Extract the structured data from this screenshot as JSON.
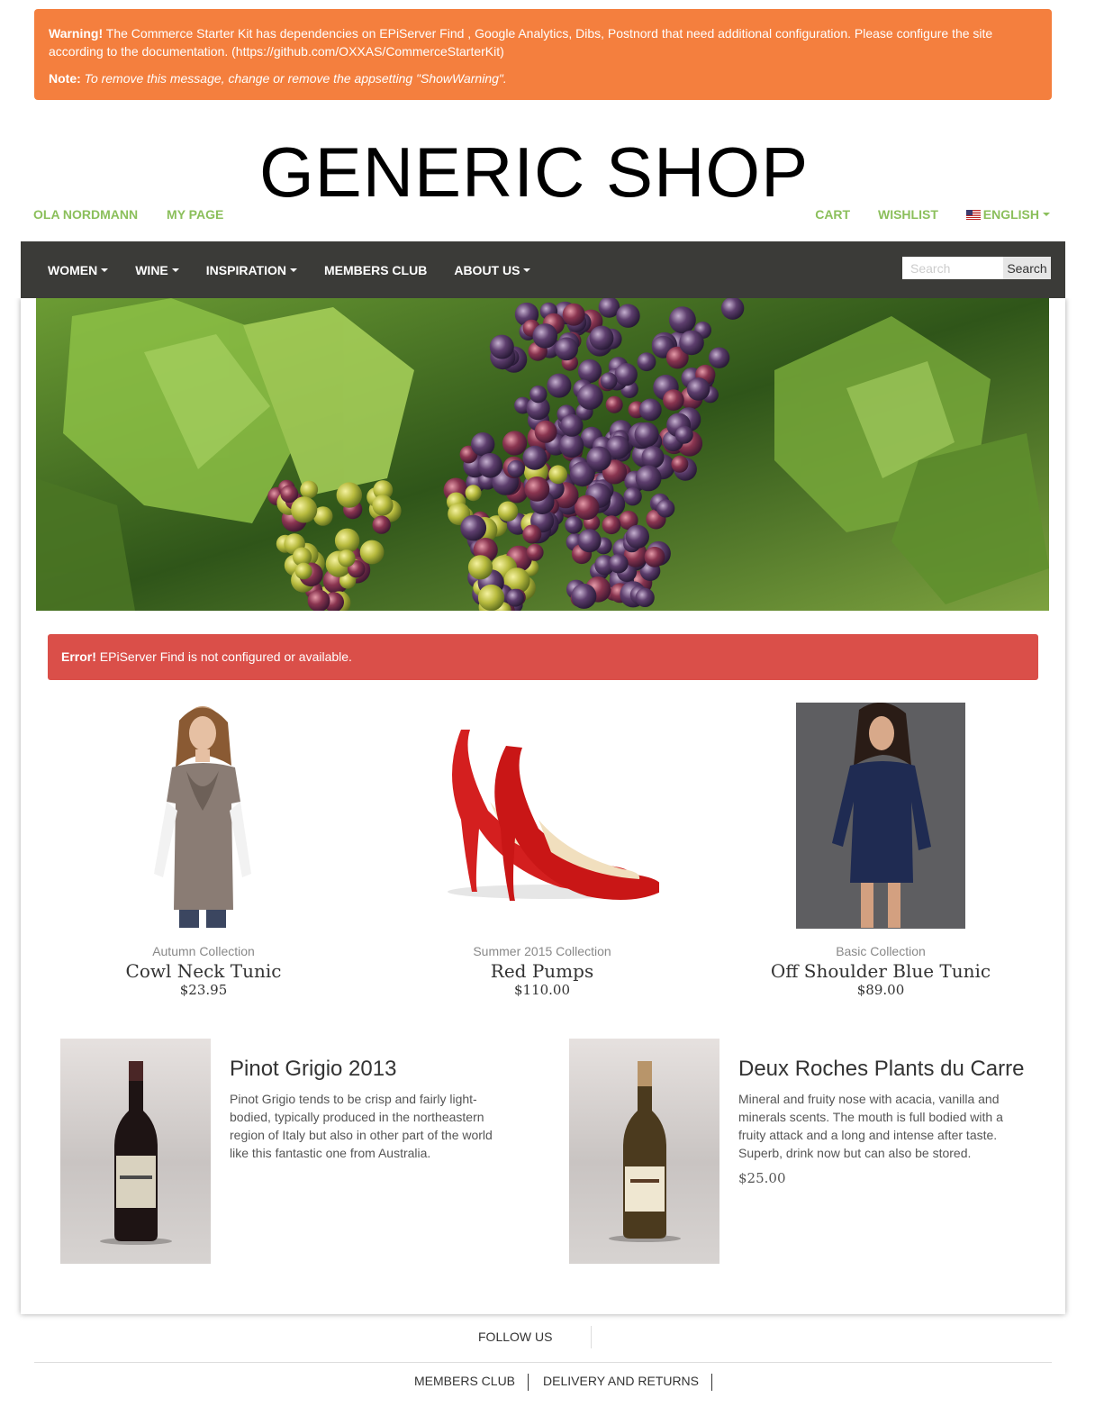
{
  "warning": {
    "label": "Warning!",
    "text": " The Commerce Starter Kit has dependencies on EPiServer Find , Google Analytics, Dibs, Postnord that need additional configuration. Please configure the site according to the documentation. (https://github.com/OXXAS/CommerceStarterKit)",
    "note_label": "Note:",
    "note_text": " To remove this message, change or remove the appsetting \"ShowWarning\"."
  },
  "logo": "GENERIC SHOP",
  "user_links": [
    "OLA NORDMANN",
    "MY PAGE"
  ],
  "account_links": {
    "cart": "CART",
    "wishlist": "WISHLIST",
    "language": "ENGLISH"
  },
  "nav": {
    "items": [
      {
        "label": "WOMEN",
        "dropdown": true
      },
      {
        "label": "WINE",
        "dropdown": true
      },
      {
        "label": "INSPIRATION",
        "dropdown": true
      },
      {
        "label": "MEMBERS CLUB",
        "dropdown": false
      },
      {
        "label": "ABOUT US",
        "dropdown": true
      }
    ],
    "search_placeholder": "Search",
    "search_button": "Search"
  },
  "error": {
    "label": "Error!",
    "text": " EPiServer Find is not configured or available."
  },
  "products": [
    {
      "collection": "Autumn Collection",
      "name": "Cowl Neck Tunic",
      "price": "$23.95"
    },
    {
      "collection": "Summer 2015 Collection",
      "name": "Red Pumps",
      "price": "$110.00"
    },
    {
      "collection": "Basic Collection",
      "name": "Off Shoulder Blue Tunic",
      "price": "$89.00"
    }
  ],
  "wines": [
    {
      "title": "Pinot Grigio 2013",
      "description": "Pinot Grigio tends to be crisp and fairly light-bodied, typically produced in the northeastern region of Italy but also in other part of the world like this fantastic one from Australia.",
      "price": ""
    },
    {
      "title": "Deux Roches Plants du Carre",
      "description": "Mineral and fruity nose with acacia, vanilla and minerals scents. The mouth is full bodied with a fruity attack and a long and intense after taste. Superb, drink now but can also be stored.",
      "price": "$25.00"
    }
  ],
  "footer": {
    "follow": "FOLLOW US",
    "links": [
      "MEMBERS CLUB",
      "DELIVERY AND RETURNS"
    ]
  },
  "colors": {
    "warning_bg": "#f47f3e",
    "error_bg": "#da4f49",
    "link_green": "#8bbf5b",
    "nav_bg": "#3b3b38"
  }
}
